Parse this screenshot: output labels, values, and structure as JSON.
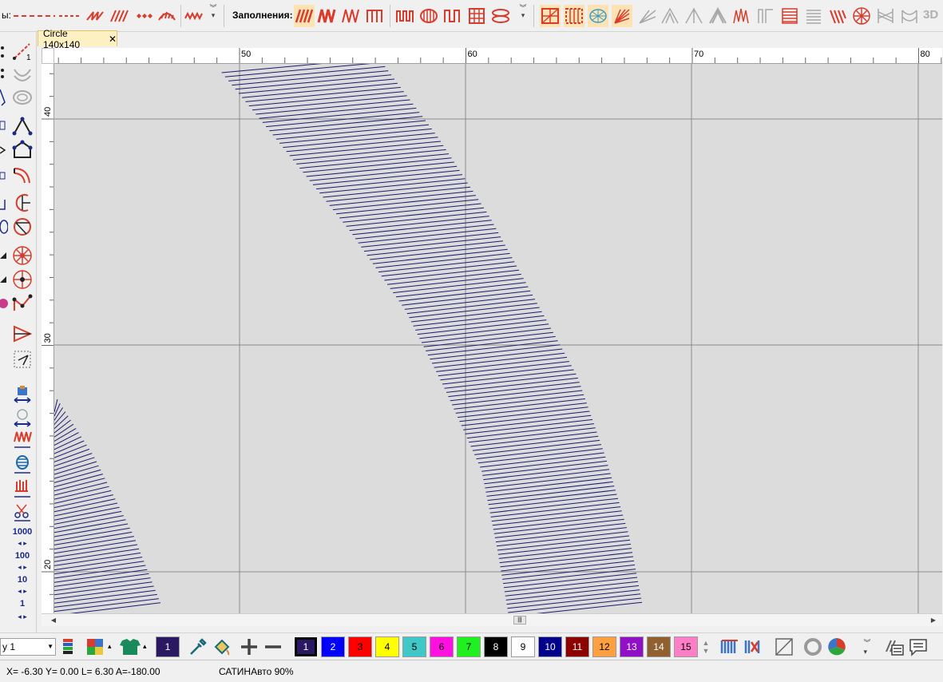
{
  "toolbar": {
    "cut_label_tail": "ы:",
    "fills_label": "Заполнения:",
    "view_3d_label": "3D"
  },
  "document": {
    "tab_title": "Circle 140x140",
    "tab_close": "✕"
  },
  "rulers": {
    "horizontal_labels": [
      "50",
      "60",
      "70",
      "80"
    ],
    "vertical_labels": [
      "40",
      "30",
      "20"
    ]
  },
  "left_tools": {
    "step_labels": [
      "1000",
      "100",
      "10",
      "1"
    ]
  },
  "bottom": {
    "layer_value": "y 1",
    "current_color_label": "1",
    "palette": [
      {
        "label": "1",
        "color": "#2a1860",
        "text_color": "#ffffff"
      },
      {
        "label": "2",
        "color": "#0000ff",
        "text_color": "#ffffff"
      },
      {
        "label": "3",
        "color": "#ff0000",
        "text_color": "#000000"
      },
      {
        "label": "4",
        "color": "#ffff00",
        "text_color": "#000000"
      },
      {
        "label": "5",
        "color": "#40c8c8",
        "text_color": "#000000"
      },
      {
        "label": "6",
        "color": "#ff10e0",
        "text_color": "#000000"
      },
      {
        "label": "7",
        "color": "#20f020",
        "text_color": "#000000"
      },
      {
        "label": "8",
        "color": "#000000",
        "text_color": "#ffffff"
      },
      {
        "label": "9",
        "color": "#ffffff",
        "text_color": "#000000"
      },
      {
        "label": "10",
        "color": "#00008c",
        "text_color": "#ffffff"
      },
      {
        "label": "11",
        "color": "#8c0000",
        "text_color": "#ffffff"
      },
      {
        "label": "12",
        "color": "#ffa040",
        "text_color": "#000000"
      },
      {
        "label": "13",
        "color": "#9010c8",
        "text_color": "#ffffff"
      },
      {
        "label": "14",
        "color": "#906030",
        "text_color": "#ffffff"
      },
      {
        "label": "15",
        "color": "#ff7ec8",
        "text_color": "#000000"
      }
    ]
  },
  "status": {
    "coords": "X=  -6.30 Y=   0.00 L=   6.30 A=-180.00",
    "mode": "САТИНАвто 90%"
  },
  "colors": {
    "stitch": "#1a1a6e",
    "accent_red": "#d83c2c",
    "canvas": "#dcdcdc",
    "grid": "#8c8c8c",
    "icon_blue": "#1a2a8a"
  }
}
